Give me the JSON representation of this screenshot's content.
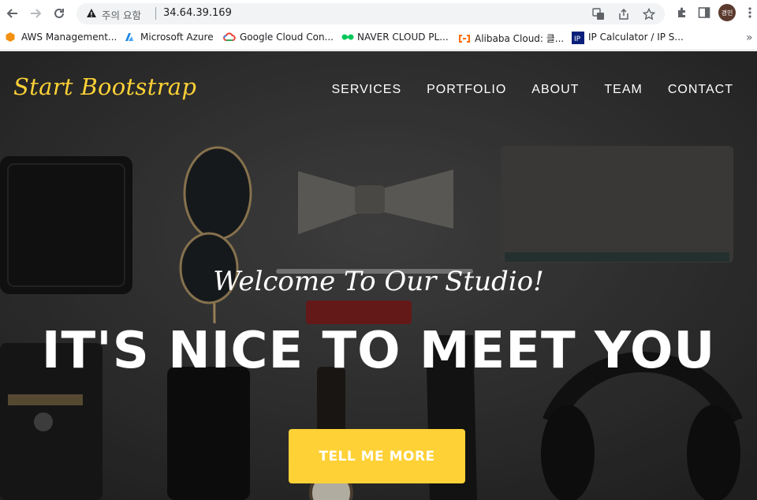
{
  "browser": {
    "security_label": "주의 요함",
    "url": "34.64.39.169",
    "profile_initials": "경민",
    "icons": [
      "back-icon",
      "forward-icon",
      "reload-icon",
      "warning-icon",
      "translate-icon",
      "share-icon",
      "star-icon",
      "extensions-icon",
      "side-panel-icon"
    ]
  },
  "bookmarks": [
    {
      "label": "AWS Management...",
      "icon": "aws-icon"
    },
    {
      "label": "Microsoft Azure",
      "icon": "azure-icon"
    },
    {
      "label": "Google Cloud Con...",
      "icon": "google-cloud-icon"
    },
    {
      "label": "NAVER CLOUD PL...",
      "icon": "naver-cloud-icon"
    },
    {
      "label": "Alibaba Cloud: 클...",
      "icon": "alibaba-icon"
    },
    {
      "label": "IP Calculator / IP S...",
      "icon": "ip-calculator-icon"
    }
  ],
  "site": {
    "brand": "Start Bootstrap",
    "nav": [
      "SERVICES",
      "PORTFOLIO",
      "ABOUT",
      "TEAM",
      "CONTACT"
    ],
    "subheading": "Welcome To Our Studio!",
    "heading": "IT'S NICE TO MEET YOU",
    "cta": "TELL ME MORE"
  },
  "colors": {
    "accent": "#fed136",
    "hero_bg": "#3b3b3b"
  }
}
